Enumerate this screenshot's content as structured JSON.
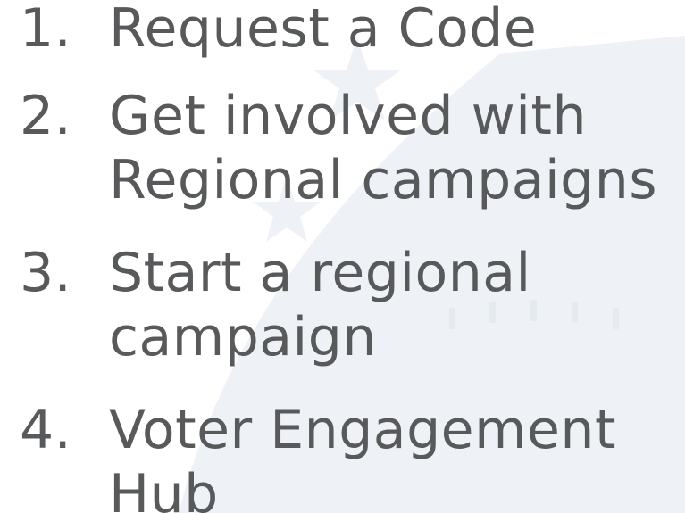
{
  "steps": [
    {
      "number": "1.",
      "label": "Request a Code"
    },
    {
      "number": "2.",
      "label": "Get involved with Regional campaigns"
    },
    {
      "number": "3.",
      "label": "Start a regional campaign"
    },
    {
      "number": "4.",
      "label": "Voter Engagement Hub"
    }
  ],
  "colors": {
    "text": "#58595b",
    "background": "#ffffff",
    "watermark": "#eef1f6"
  },
  "icons": {
    "background": "capitol-dome-stars-icon"
  }
}
